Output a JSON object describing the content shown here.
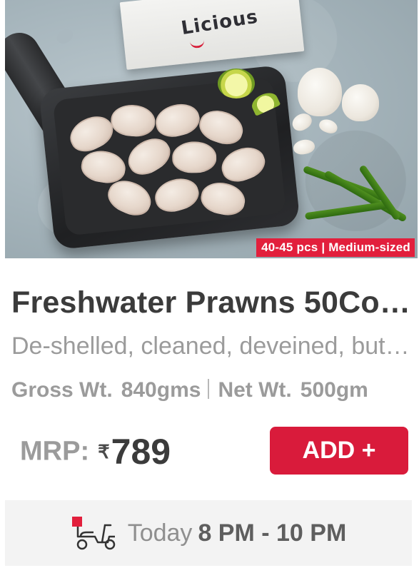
{
  "product": {
    "brand": "Licious",
    "badge": "40-45 pcs | Medium-sized",
    "title": "Freshwater Prawns 50Co…",
    "description": "De-shelled, cleaned, deveined, but…",
    "gross_label": "Gross Wt.",
    "gross_value": "840gms",
    "net_label": "Net Wt.",
    "net_value": "500gm",
    "mrp_label": "MRP:",
    "currency_symbol": "₹",
    "price": "789",
    "add_label": "ADD +"
  },
  "delivery": {
    "icon": "scooter-icon",
    "day": "Today",
    "slot": "8 PM - 10 PM"
  },
  "colors": {
    "accent": "#d91b3b",
    "badge_bg": "#e21f3c",
    "text_dark": "#3b3b3b",
    "text_muted": "#9b9b9b",
    "delivery_bg": "#f3f3f3"
  }
}
